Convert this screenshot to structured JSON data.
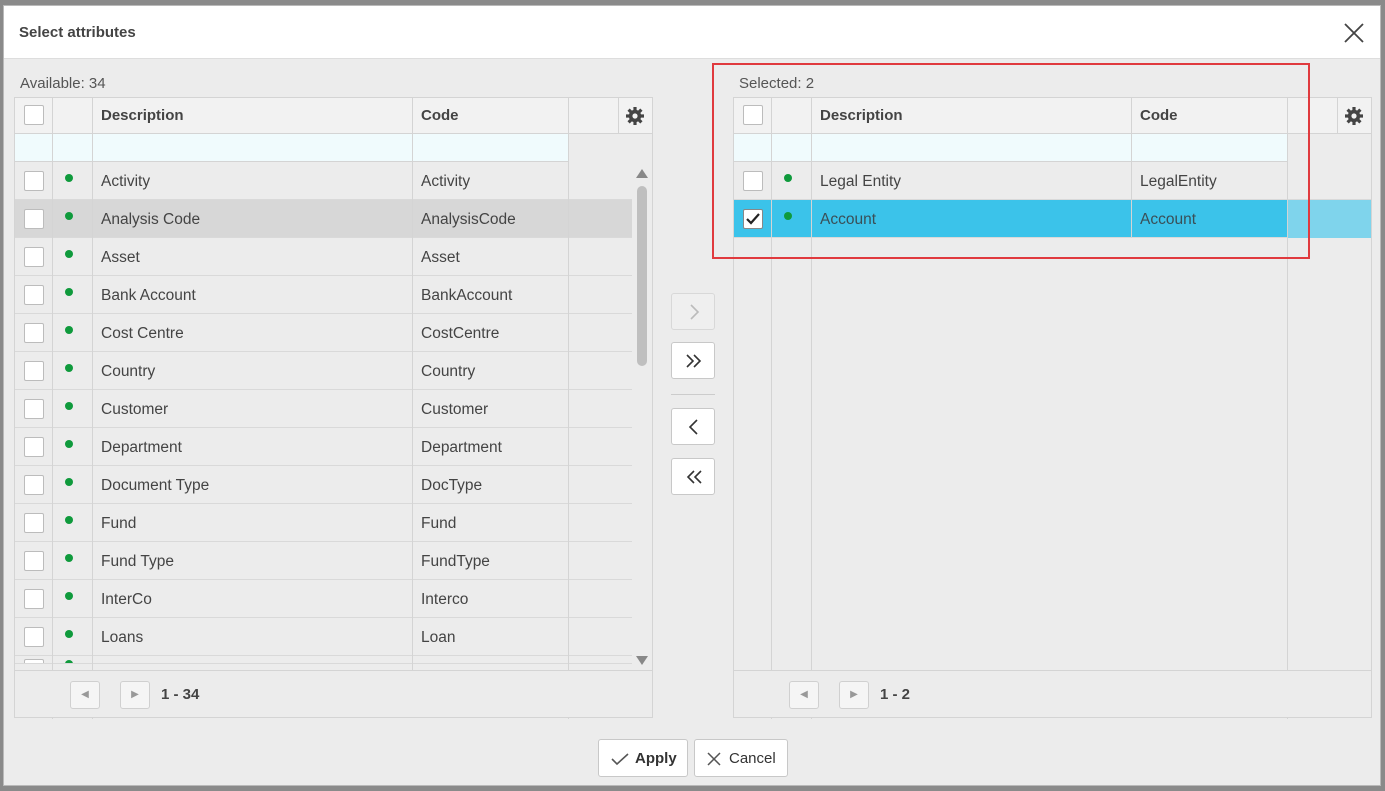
{
  "dialog": {
    "title": "Select attributes"
  },
  "available": {
    "count_label": "Available: 34",
    "columns": {
      "description": "Description",
      "code": "Code"
    },
    "rows": [
      {
        "description": "Activity",
        "code": "Activity"
      },
      {
        "description": "Analysis Code",
        "code": "AnalysisCode"
      },
      {
        "description": "Asset",
        "code": "Asset"
      },
      {
        "description": "Bank Account",
        "code": "BankAccount"
      },
      {
        "description": "Cost Centre",
        "code": "CostCentre"
      },
      {
        "description": "Country",
        "code": "Country"
      },
      {
        "description": "Customer",
        "code": "Customer"
      },
      {
        "description": "Department",
        "code": "Department"
      },
      {
        "description": "Document Type",
        "code": "DocType"
      },
      {
        "description": "Fund",
        "code": "Fund"
      },
      {
        "description": "Fund Type",
        "code": "FundType"
      },
      {
        "description": "InterCo",
        "code": "Interco"
      },
      {
        "description": "Loans",
        "code": "Loan"
      }
    ],
    "page_range": "1 - 34"
  },
  "selected": {
    "count_label": "Selected: 2",
    "columns": {
      "description": "Description",
      "code": "Code"
    },
    "rows": [
      {
        "description": "Legal Entity",
        "code": "LegalEntity"
      },
      {
        "description": "Account",
        "code": "Account"
      }
    ],
    "page_range": "1 - 2"
  },
  "actions": {
    "apply": "Apply",
    "cancel": "Cancel"
  },
  "colors": {
    "selected_row": "#3bc3ea",
    "status_dot": "#0f9a3c",
    "highlight_box": "#e03a3e"
  }
}
